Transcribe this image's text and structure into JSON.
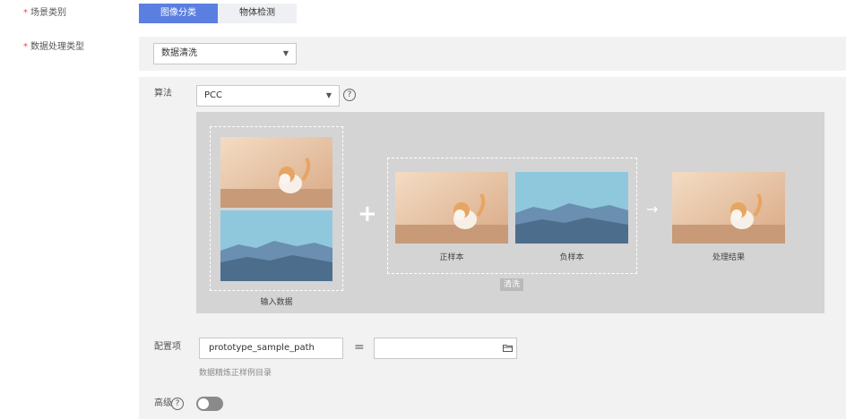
{
  "scene_type": {
    "label": "场景类别",
    "required_mark": "*",
    "options": [
      "图像分类",
      "物体检测"
    ],
    "selected": "图像分类"
  },
  "processing_type": {
    "label": "数据处理类型",
    "required_mark": "*",
    "value": "数据清洗"
  },
  "algorithm": {
    "label": "算法",
    "value": "PCC",
    "help_icon": "question-circle-icon"
  },
  "diagram": {
    "input_caption": "输入数据",
    "positive_caption": "正样本",
    "negative_caption": "负样本",
    "clean_tag": "清洗",
    "result_caption": "处理结果"
  },
  "config": {
    "label": "配置项",
    "key_value": "prototype_sample_path",
    "equals": "=",
    "value": "",
    "hint": "数据精炼正样例目录",
    "folder_icon": "folder-icon"
  },
  "advanced": {
    "label": "高级",
    "help_icon": "question-circle-icon",
    "enabled": false
  },
  "colors": {
    "accent": "#5b7fe0",
    "required": "#f04747",
    "stage_bg": "#d4d4d4",
    "panel_bg": "#f2f2f2"
  }
}
